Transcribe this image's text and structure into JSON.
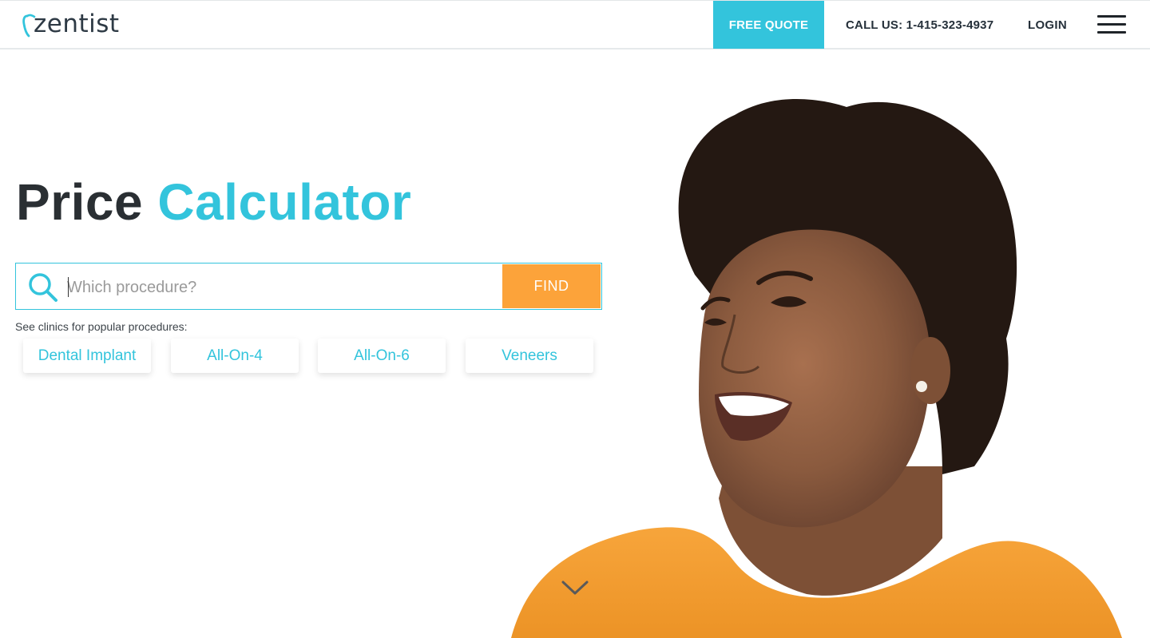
{
  "header": {
    "logo_text": "zentist",
    "free_quote_label": "FREE QUOTE",
    "call_us_label": "CALL US: 1-415-323-4937",
    "login_label": "LOGIN",
    "menu_icon": "hamburger-menu-icon"
  },
  "hero": {
    "title_part1": "Price",
    "title_part2": "Calculator",
    "search": {
      "placeholder": "Which procedure?",
      "value": "",
      "icon": "search-icon",
      "find_label": "FIND"
    },
    "popular_label": "See clinics for popular procedures:",
    "procedures": [
      "Dental Implant",
      "All-On-4",
      "All-On-6",
      "Veneers"
    ],
    "scroll_icon": "chevron-down-icon"
  },
  "colors": {
    "accent": "#33c4dc",
    "find_button": "#fca33a",
    "text_dark": "#2a2f33"
  }
}
